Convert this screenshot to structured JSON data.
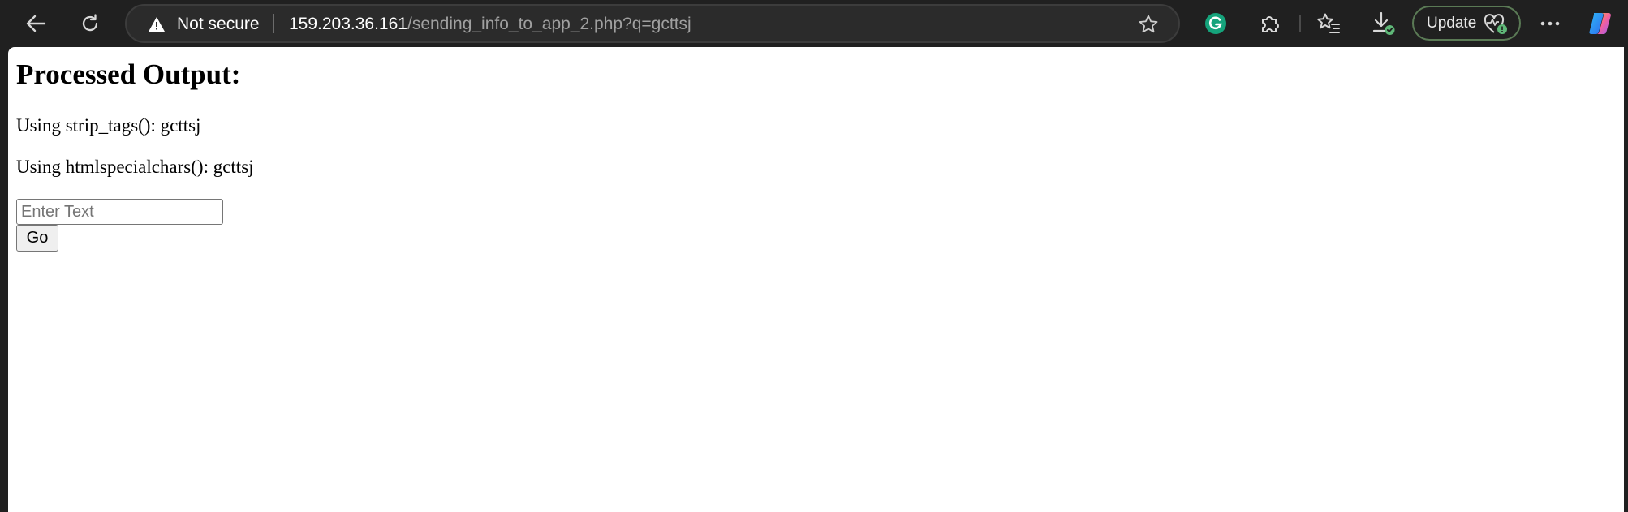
{
  "browser": {
    "address_bar": {
      "security_label": "Not secure",
      "url_host": "159.203.36.161",
      "url_path": "/sending_info_to_app_2.php?q=gcttsj"
    },
    "update_button_label": "Update",
    "icons": {
      "back": "back-arrow-icon",
      "reload": "reload-icon",
      "warning": "warning-triangle-icon",
      "favorite": "star-icon",
      "grammarly": "grammarly-icon",
      "extensions": "puzzle-piece-icon",
      "favorites": "favorites-list-icon",
      "downloads": "download-icon",
      "health": "heart-pulse-icon",
      "menu": "more-dots-icon",
      "copilot": "copilot-icon"
    }
  },
  "page": {
    "heading": "Processed Output:",
    "strip_tags_line": "Using strip_tags(): gcttsj",
    "htmlspecialchars_line": "Using htmlspecialchars(): gcttsj",
    "input_placeholder": "Enter Text",
    "input_value": "",
    "submit_label": "Go"
  }
}
